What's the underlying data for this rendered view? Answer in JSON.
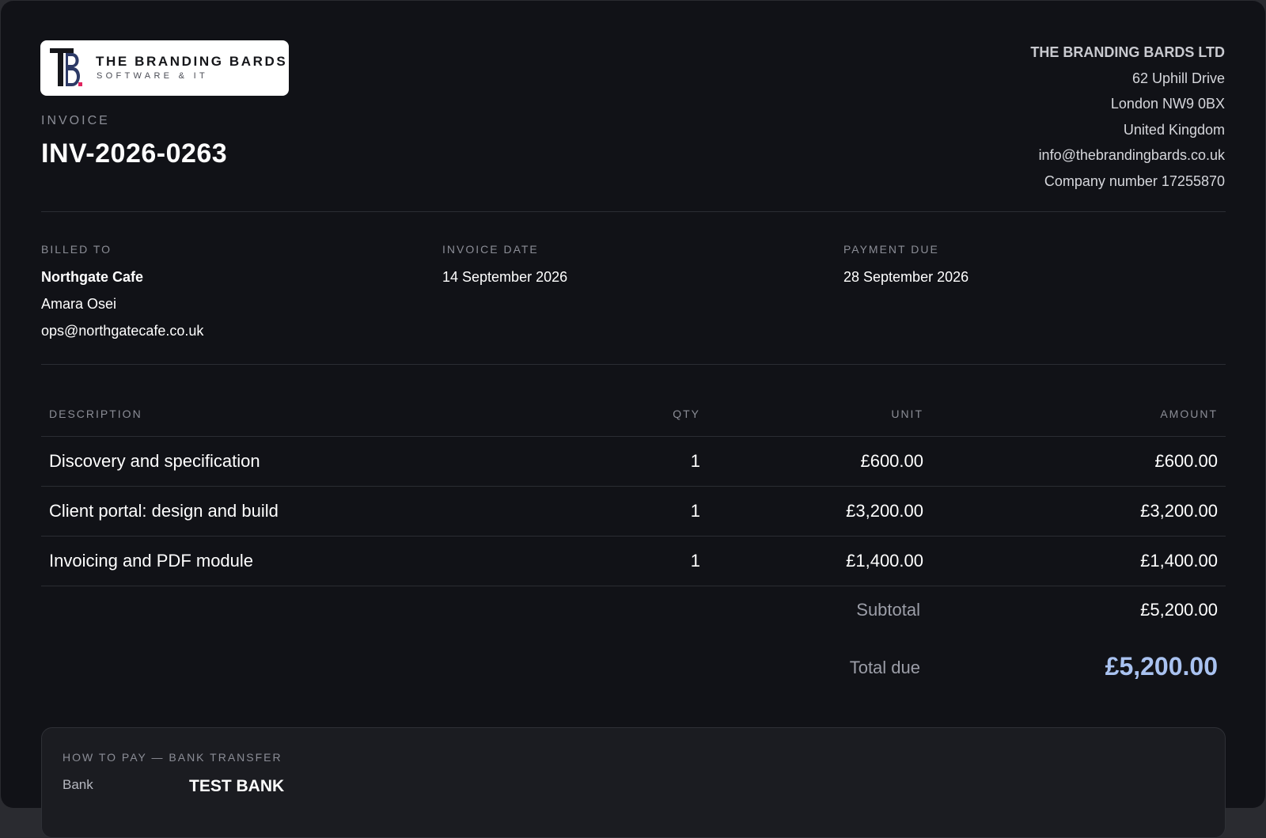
{
  "brand": {
    "logo_name": "THE BRANDING BARDS",
    "logo_tagline": "SOFTWARE & IT"
  },
  "invoice": {
    "label": "INVOICE",
    "number": "INV-2026-0263"
  },
  "company": {
    "name": "THE BRANDING BARDS LTD",
    "address_line1": "62 Uphill Drive",
    "address_line2": "London NW9 0BX",
    "country": "United Kingdom",
    "email": "info@thebrandingbards.co.uk",
    "company_number": "Company number 17255870"
  },
  "meta": {
    "billed_to_label": "BILLED TO",
    "client_name": "Northgate Cafe",
    "contact_name": "Amara Osei",
    "contact_email": "ops@northgatecafe.co.uk",
    "invoice_date_label": "INVOICE DATE",
    "invoice_date": "14 September 2026",
    "payment_due_label": "PAYMENT DUE",
    "payment_due": "28 September 2026"
  },
  "table": {
    "headers": {
      "description": "DESCRIPTION",
      "qty": "QTY",
      "unit": "UNIT",
      "amount": "AMOUNT"
    },
    "rows": [
      {
        "description": "Discovery and specification",
        "qty": "1",
        "unit": "£600.00",
        "amount": "£600.00"
      },
      {
        "description": "Client portal: design and build",
        "qty": "1",
        "unit": "£3,200.00",
        "amount": "£3,200.00"
      },
      {
        "description": "Invoicing and PDF module",
        "qty": "1",
        "unit": "£1,400.00",
        "amount": "£1,400.00"
      }
    ]
  },
  "totals": {
    "subtotal_label": "Subtotal",
    "subtotal_value": "£5,200.00",
    "total_label": "Total due",
    "total_value": "£5,200.00"
  },
  "payment": {
    "title": "HOW TO PAY — BANK TRANSFER",
    "bank_label": "Bank",
    "bank_value": "TEST BANK"
  },
  "colors": {
    "background": "#111217",
    "accent_total": "#a9c2f0",
    "logo_accent": "#e0245e"
  }
}
